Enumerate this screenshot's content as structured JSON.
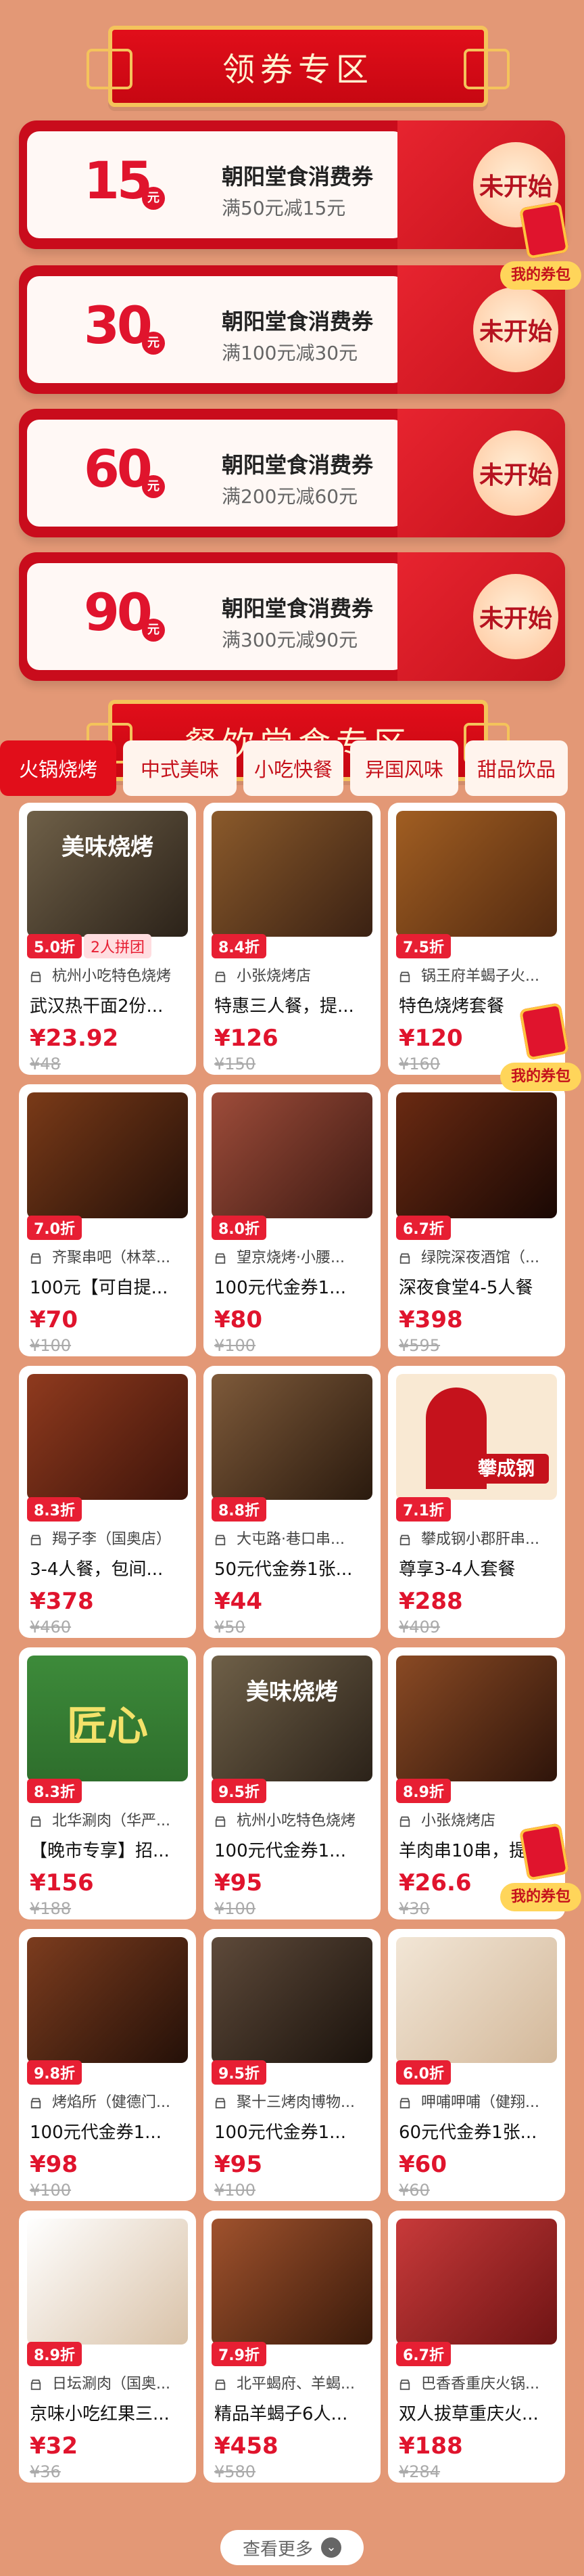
{
  "coupon_zone": {
    "title": "领券专区",
    "coupons": [
      {
        "amount": "15",
        "yuan": "元",
        "title": "朝阳堂食消费券",
        "condition": "满50元减15元",
        "status": "未开始"
      },
      {
        "amount": "30",
        "yuan": "元",
        "title": "朝阳堂食消费券",
        "condition": "满100元减30元",
        "status": "未开始"
      },
      {
        "amount": "60",
        "yuan": "元",
        "title": "朝阳堂食消费券",
        "condition": "满200元减60元",
        "status": "未开始"
      },
      {
        "amount": "90",
        "yuan": "元",
        "title": "朝阳堂食消费券",
        "condition": "满300元减90元",
        "status": "未开始"
      }
    ],
    "my_coupon_label": "我的券包"
  },
  "dining_zone": {
    "title": "餐饮堂食专区",
    "tabs": [
      "火锅烧烤",
      "中式美味",
      "小吃快餐",
      "异国风味",
      "甜品饮品"
    ],
    "active_tab": 0,
    "products": [
      {
        "badge": "5.0折",
        "group": "2人拼团",
        "shop": "杭州小吃特色烧烤",
        "title": "武汉热干面2份...",
        "price": "¥23.92",
        "original": "¥48",
        "img_text": "美味烧烤"
      },
      {
        "badge": "8.4折",
        "shop": "小张烧烤店",
        "title": "特惠三人餐，提...",
        "price": "¥126",
        "original": "¥150"
      },
      {
        "badge": "7.5折",
        "shop": "锅王府羊蝎子火...",
        "title": "特色烧烤套餐",
        "price": "¥120",
        "original": "¥160"
      },
      {
        "badge": "7.0折",
        "shop": "齐聚串吧（林萃...",
        "title": "100元【可自提...",
        "price": "¥70",
        "original": "¥100"
      },
      {
        "badge": "8.0折",
        "shop": "望京烧烤·小腰...",
        "title": "100元代金券1...",
        "price": "¥80",
        "original": "¥100"
      },
      {
        "badge": "6.7折",
        "shop": "绿院深夜酒馆（...",
        "title": "深夜食堂4-5人餐",
        "price": "¥398",
        "original": "¥595"
      },
      {
        "badge": "8.3折",
        "shop": "羯子李（国奥店）",
        "title": "3-4人餐，包间...",
        "price": "¥378",
        "original": "¥460"
      },
      {
        "badge": "8.8折",
        "shop": "大屯路·巷口串...",
        "title": "50元代金券1张...",
        "price": "¥44",
        "original": "¥50"
      },
      {
        "badge": "7.1折",
        "shop": "攀成钢小郡肝串...",
        "title": "尊享3-4人套餐",
        "price": "¥288",
        "original": "¥409",
        "img_text": "攀成钢"
      },
      {
        "badge": "8.3折",
        "shop": "北华涮肉（华严...",
        "title": "【晚市专享】招...",
        "price": "¥156",
        "original": "¥188",
        "img_text": "匠心"
      },
      {
        "badge": "9.5折",
        "shop": "杭州小吃特色烧烤",
        "title": "100元代金券1...",
        "price": "¥95",
        "original": "¥100",
        "img_text": "美味烧烤"
      },
      {
        "badge": "8.9折",
        "shop": "小张烧烤店",
        "title": "羊肉串10串，提...",
        "price": "¥26.6",
        "original": "¥30"
      },
      {
        "badge": "9.8折",
        "shop": "烤焰所（健德门...",
        "title": "100元代金券1...",
        "price": "¥98",
        "original": "¥100"
      },
      {
        "badge": "9.5折",
        "shop": "聚十三烤肉博物...",
        "title": "100元代金券1...",
        "price": "¥95",
        "original": "¥100"
      },
      {
        "badge": "6.0折",
        "shop": "呷哺呷哺（健翔...",
        "title": "60元代金券1张...",
        "price": "¥60",
        "original": "¥60"
      },
      {
        "badge": "8.9折",
        "shop": "日坛涮肉（国奥...",
        "title": "京味小吃红果三...",
        "price": "¥32",
        "original": "¥36"
      },
      {
        "badge": "7.9折",
        "shop": "北平蝎府、羊蝎...",
        "title": "精品羊蝎子6人...",
        "price": "¥458",
        "original": "¥580"
      },
      {
        "badge": "6.7折",
        "shop": "巴香香重庆火锅...",
        "title": "双人拔草重庆火...",
        "price": "¥188",
        "original": "¥284"
      }
    ],
    "more_label": "查看更多"
  },
  "colors": {
    "primary": "#E10E1A",
    "gold": "#F4C35B",
    "background": "#E39876"
  },
  "icons": [
    "shop-icon",
    "red-envelope-icon",
    "chevron-down-icon"
  ]
}
